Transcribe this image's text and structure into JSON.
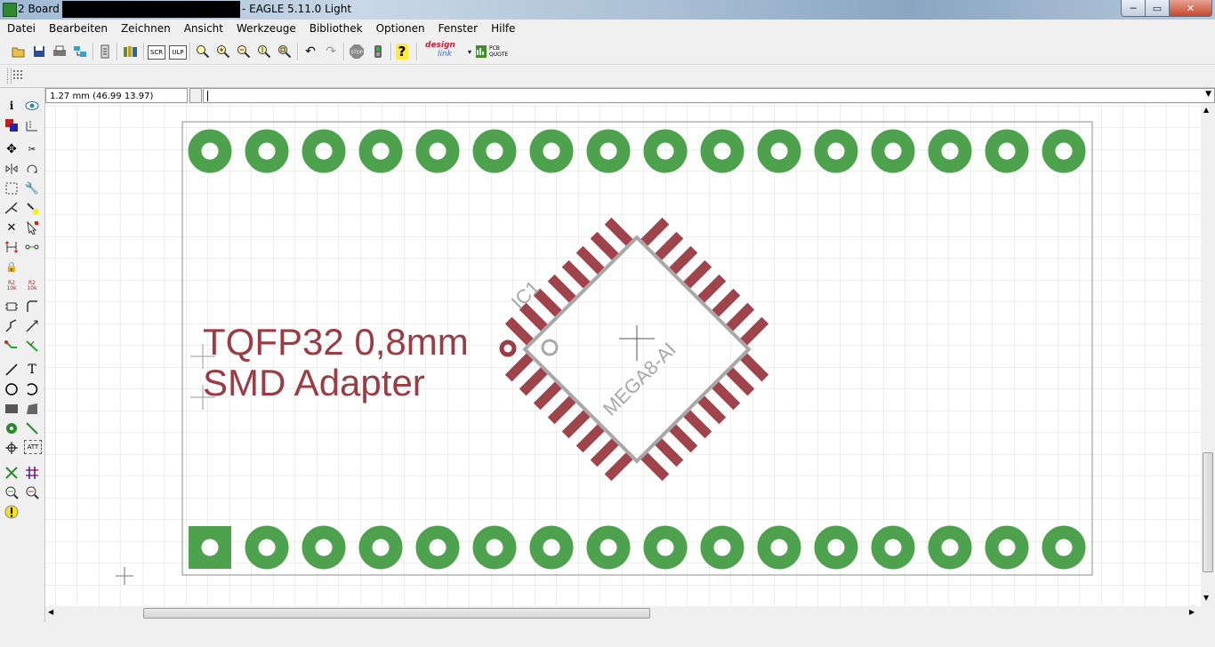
{
  "window": {
    "title_prefix": "2 Board -",
    "title_suffix": "- EAGLE 5.11.0 Light",
    "min_glyph": "─",
    "max_glyph": "▭",
    "close_glyph": "✕"
  },
  "menu": {
    "items": [
      {
        "label": "Datei"
      },
      {
        "label": "Bearbeiten"
      },
      {
        "label": "Zeichnen"
      },
      {
        "label": "Ansicht"
      },
      {
        "label": "Werkzeuge"
      },
      {
        "label": "Bibliothek"
      },
      {
        "label": "Optionen"
      },
      {
        "label": "Fenster"
      },
      {
        "label": "Hilfe"
      }
    ]
  },
  "toolbar": {
    "icons": [
      "open-icon",
      "save-icon",
      "print-icon",
      "cam-icon",
      "script-icon",
      "library-icon",
      "scr-icon",
      "ulp-icon",
      "zoom-fit-icon",
      "zoom-in-icon",
      "zoom-out-icon",
      "zoom-select-icon",
      "zoom-window-icon",
      "undo-icon",
      "redo-icon",
      "stop-icon",
      "go-icon",
      "help-icon",
      "designlink-icon",
      "pcb-quote-icon"
    ],
    "scr_label": "SCR",
    "ulp_label": "ULP",
    "stop_label": "STOP",
    "designlink_label_1": "design",
    "designlink_label_2": "link",
    "pcb_label_1": "PCB",
    "pcb_label_2": "QUOTE"
  },
  "command": {
    "coordinates": "1.27 mm (46.99 13.97)",
    "value": ""
  },
  "board": {
    "title_line_1": "TQFP32 0,8mm",
    "title_line_2": "SMD Adapter",
    "ic_name": "IC1",
    "ic_value": "MEGA8-AI",
    "pads_per_row": 16,
    "pins_per_side": 8,
    "pad_color": "#4ea24e",
    "smd_color": "#a0444b",
    "text_color": "#9b3c44",
    "silk_color": "#a8a8a8",
    "grid_color": "#d9d9d9"
  }
}
